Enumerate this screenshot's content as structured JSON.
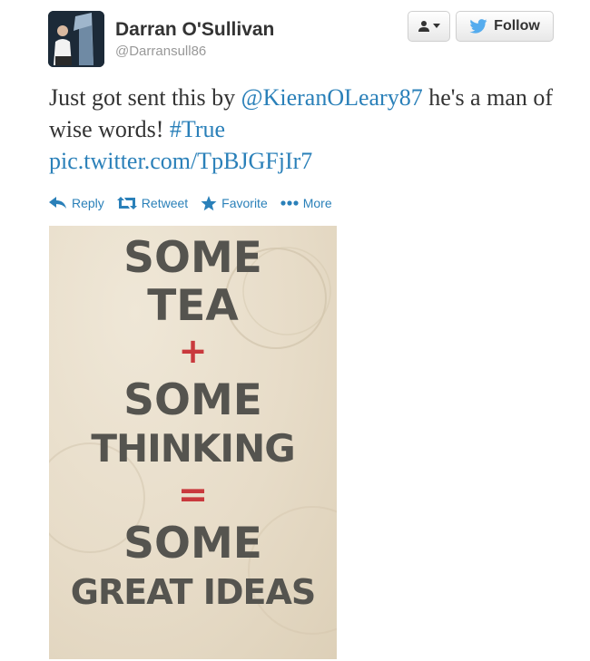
{
  "tweet": {
    "author_name": "Darran O'Sullivan",
    "author_handle": "@Darransull86",
    "text_before_mention": "Just got sent this by ",
    "mention": "@KieranOLeary87",
    "text_after_mention": " he's a man of wise words! ",
    "hashtag": "#True",
    "media_link": "pic.twitter.com/TpBJGFjIr7"
  },
  "header": {
    "follow_label": "Follow"
  },
  "actions": [
    {
      "label": "Reply",
      "icon": "reply-icon"
    },
    {
      "label": "Retweet",
      "icon": "retweet-icon"
    },
    {
      "label": "Favorite",
      "icon": "star-icon"
    },
    {
      "label": "More",
      "icon": "more-dots-icon"
    }
  ],
  "poster": {
    "lines": [
      "SOME",
      "TEA",
      "+",
      "SOME",
      "THINKING",
      "=",
      "SOME",
      "GREAT IDEAS"
    ],
    "text_color": "#55544f",
    "operator_color": "#c9393d"
  },
  "colors": {
    "link": "#2a80b9",
    "twitter_bird": "#55acee",
    "text": "#333333"
  }
}
